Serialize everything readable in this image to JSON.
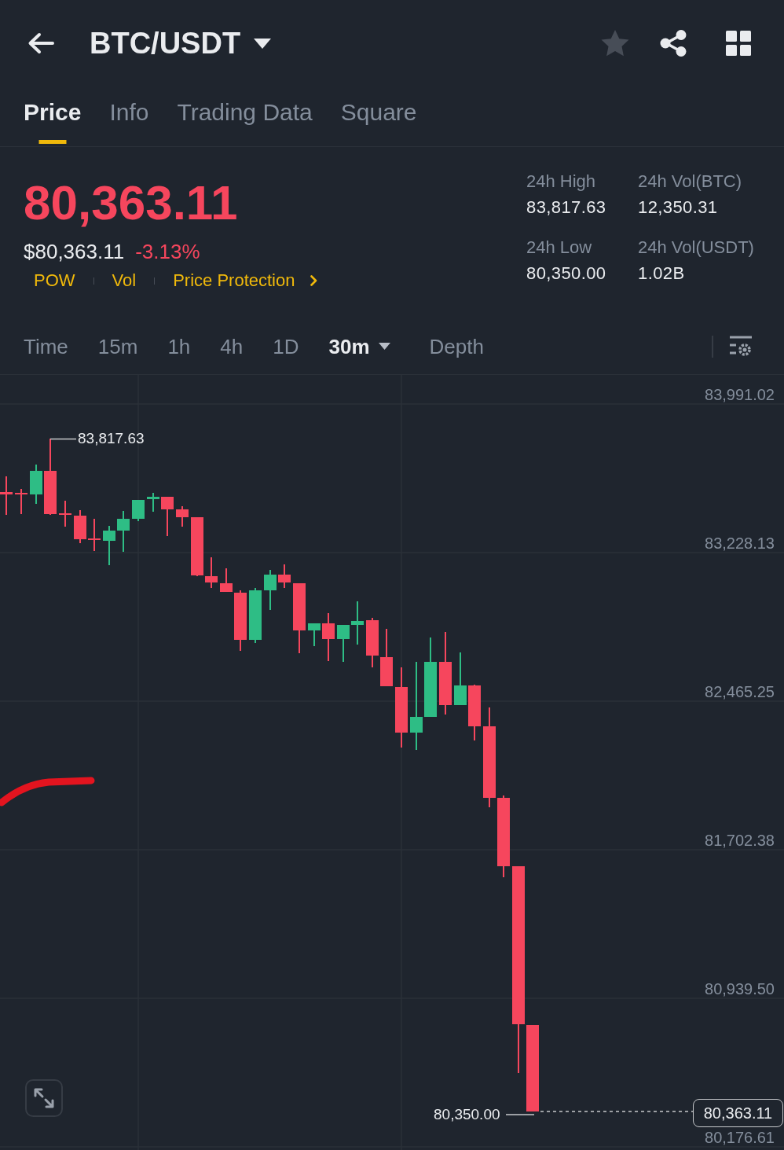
{
  "header": {
    "title": "BTC/USDT",
    "favorite": false
  },
  "tabs": [
    {
      "label": "Price",
      "selected": true
    },
    {
      "label": "Info",
      "selected": false
    },
    {
      "label": "Trading Data",
      "selected": false
    },
    {
      "label": "Square",
      "selected": false
    }
  ],
  "ticker": {
    "last_price": "80,363.11",
    "falling": true,
    "usd_price": "$80,363.11",
    "change": "-3.13%",
    "tags": [
      {
        "label": "POW",
        "kind": "tag"
      },
      {
        "label": "Vol",
        "kind": "tag"
      },
      {
        "label": "Price Protection",
        "kind": "link"
      }
    ]
  },
  "stats": [
    {
      "label": "24h High",
      "value": "83,817.63"
    },
    {
      "label": "24h Vol(BTC)",
      "value": "12,350.31"
    },
    {
      "label": "24h Low",
      "value": "80,350.00"
    },
    {
      "label": "24h Vol(USDT)",
      "value": "1.02B"
    }
  ],
  "intervals": [
    {
      "label": "Time",
      "kind": "option",
      "selected": false
    },
    {
      "label": "15m",
      "kind": "option",
      "selected": false
    },
    {
      "label": "1h",
      "kind": "option",
      "selected": false
    },
    {
      "label": "4h",
      "kind": "option",
      "selected": false
    },
    {
      "label": "1D",
      "kind": "option",
      "selected": false
    },
    {
      "label": "30m",
      "kind": "dropdown",
      "selected": true
    },
    {
      "label": "Depth",
      "kind": "option",
      "selected": false
    }
  ],
  "chart": {
    "price_axis": [
      "83,991.02",
      "83,228.13",
      "82,465.25",
      "81,702.38",
      "80,939.50",
      "80,176.61"
    ],
    "high_label": "83,817.63",
    "low_label": "80,350.00",
    "last_price_tag": "80,363.11"
  }
}
